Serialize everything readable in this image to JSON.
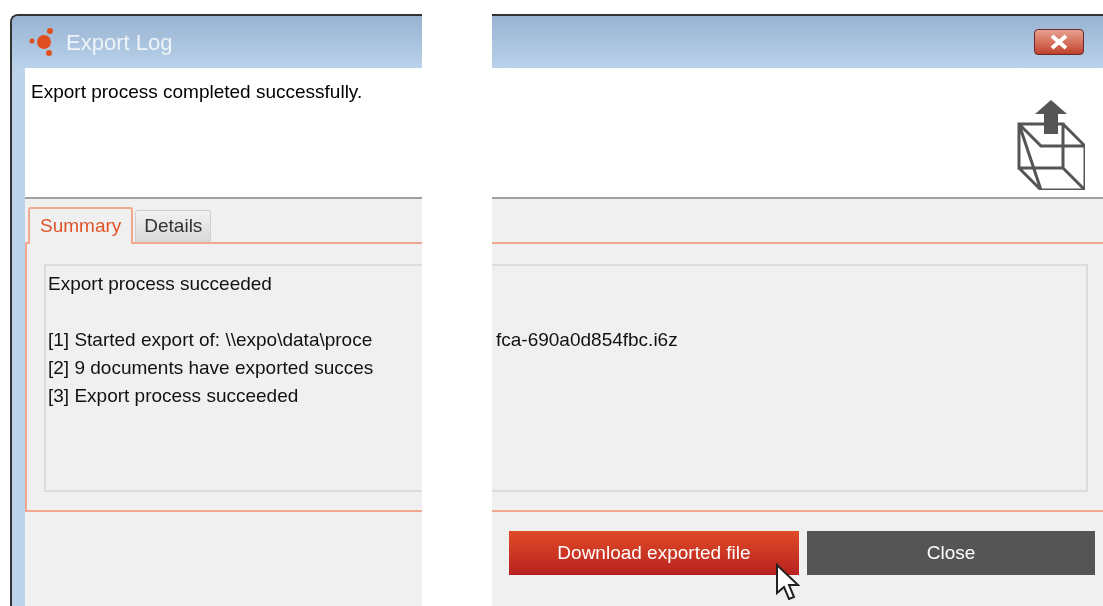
{
  "window": {
    "title": "Export Log"
  },
  "message": "Export process completed successfully.",
  "tabs": [
    {
      "label": "Summary",
      "selected": true
    },
    {
      "label": "Details",
      "selected": false
    }
  ],
  "log": {
    "heading": "Export process succeeded",
    "lines": [
      {
        "left": "[1] Started export of: \\\\expo\\data\\proce",
        "right": "fca-690a0d854fbc.i6z"
      },
      {
        "left": "[2] 9 documents have exported succes"
      },
      {
        "left": "[3] Export process succeeded"
      }
    ]
  },
  "buttons": [
    {
      "label": "Download exported file",
      "kind": "primary"
    },
    {
      "label": "Close",
      "kind": "secondary"
    }
  ]
}
